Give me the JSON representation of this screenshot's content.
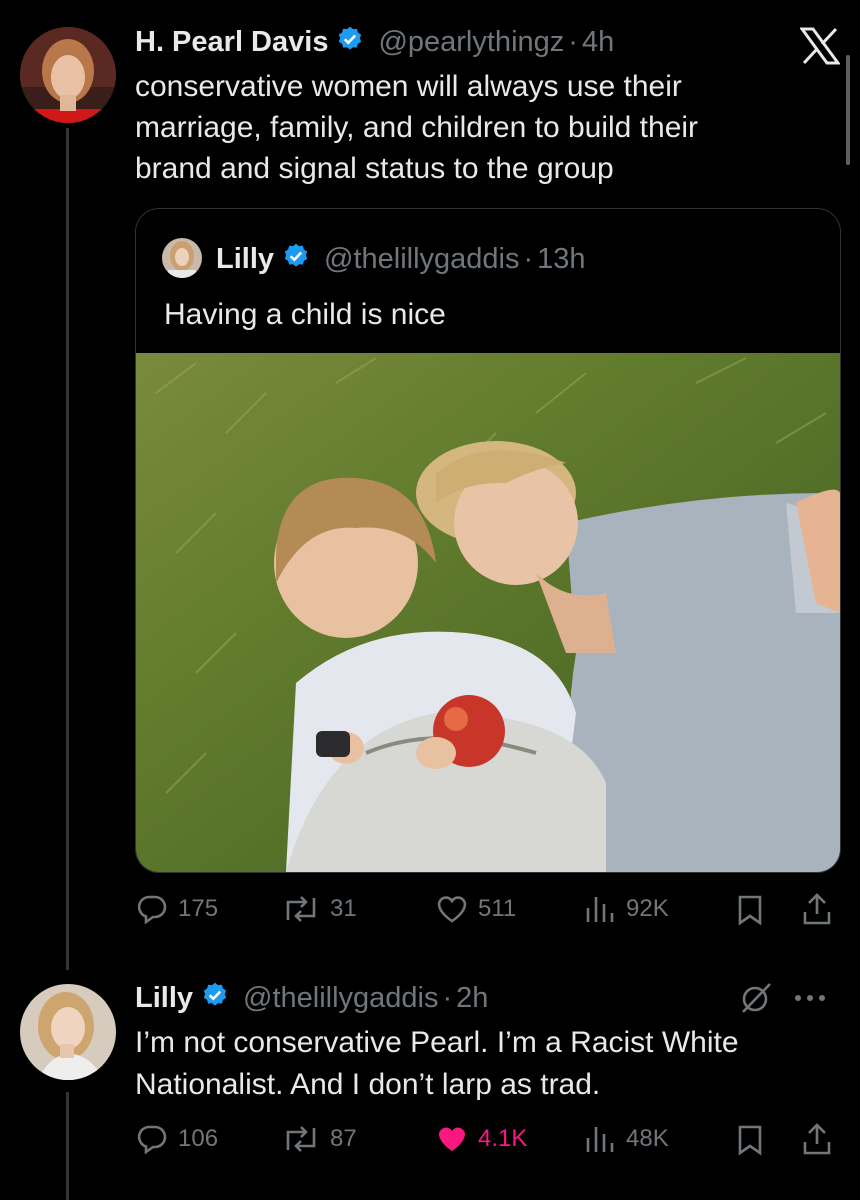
{
  "platform_logo": "x-logo-icon",
  "tweet1": {
    "name": "H. Pearl Davis",
    "handle": "@pearlythingz",
    "separator": "·",
    "time": "4h",
    "text_lines": [
      "conservative women will always use their",
      "marriage, family, and children to build their",
      "brand and signal status to the group"
    ],
    "quote": {
      "name": "Lilly",
      "handle": "@thelillygaddis",
      "separator": "·",
      "time": "13h",
      "text": "Having a child is nice",
      "image_description_icon": "photo"
    },
    "actions": {
      "replies": "175",
      "reposts": "31",
      "likes": "511",
      "views": "92K"
    }
  },
  "tweet2": {
    "name": "Lilly",
    "handle": "@thelillygaddis",
    "separator": "·",
    "time": "2h",
    "text_lines": [
      "I’m not conservative Pearl. I’m a Racist White",
      "Nationalist. And I don’t larp as trad."
    ],
    "actions": {
      "replies": "106",
      "reposts": "87",
      "likes": "4.1K",
      "views": "48K"
    }
  },
  "colors": {
    "background": "#000000",
    "text": "#e7e9ea",
    "muted": "#71767b",
    "verified": "#1d9bf0",
    "like": "#f91880"
  }
}
